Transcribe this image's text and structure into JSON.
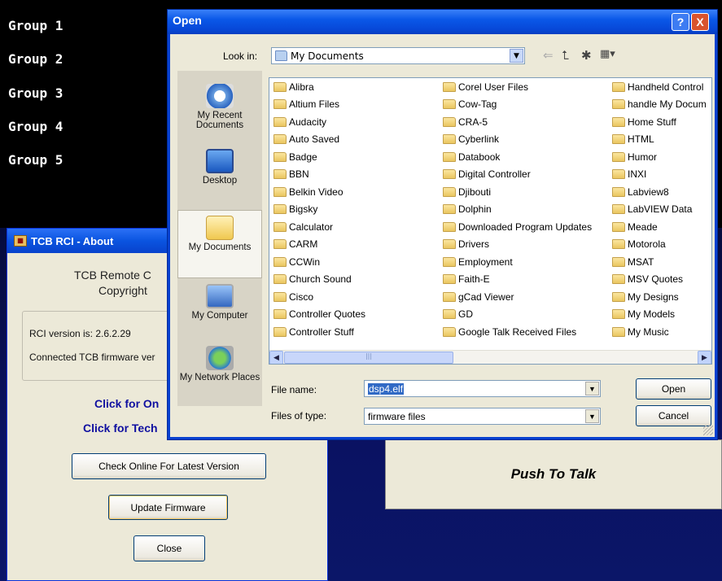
{
  "groups": [
    "Group 1",
    "Group 2",
    "Group 3",
    "Group 4",
    "Group 5"
  ],
  "push_to_talk": "Push To Talk",
  "about": {
    "title": "TCB RCI - About",
    "line1": "TCB Remote C",
    "line2": "Copyright",
    "rci_version": "RCI version is: 2.6.2.29",
    "firmware_ver": "Connected TCB firmware ver",
    "link1": "Click for On",
    "link2": "Click for Tech",
    "check_button": "Check Online For Latest Version",
    "update_button": "Update Firmware",
    "close_button": "Close"
  },
  "open_dialog": {
    "title": "Open",
    "help": "?",
    "close": "X",
    "look_in_label": "Look in:",
    "look_in_value": "My Documents",
    "places": [
      "My Recent Documents",
      "Desktop",
      "My Documents",
      "My Computer",
      "My Network Places"
    ],
    "files_col1": [
      "Alibra",
      "Altium Files",
      "Audacity",
      "Auto Saved",
      "Badge",
      "BBN",
      "Belkin Video",
      "Bigsky",
      "Calculator",
      "CARM",
      "CCWin",
      "Church Sound",
      "Cisco",
      "Controller Quotes",
      "Controller Stuff"
    ],
    "files_col2": [
      "Corel User Files",
      "Cow-Tag",
      "CRA-5",
      "Cyberlink",
      "Databook",
      "Digital Controller",
      "Djibouti",
      "Dolphin",
      "Downloaded Program Updates",
      "Drivers",
      "Employment",
      "Faith-E",
      "gCad Viewer",
      "GD",
      "Google Talk Received Files"
    ],
    "files_col3": [
      "Handheld Control",
      "handle My Docum",
      "Home Stuff",
      "HTML",
      "Humor",
      "INXI",
      "Labview8",
      "LabVIEW Data",
      "Meade",
      "Motorola",
      "MSAT",
      "MSV Quotes",
      "My Designs",
      "My Models",
      "My Music"
    ],
    "file_name_label": "File name:",
    "file_name_value": "dsp4.elf",
    "files_of_type_label": "Files of type:",
    "files_of_type_value": "firmware files",
    "open_button": "Open",
    "cancel_button": "Cancel"
  },
  "colors": {
    "xp_title": "#0a54e0",
    "dialog_bg": "#ece9d8",
    "link": "#1010a0"
  }
}
